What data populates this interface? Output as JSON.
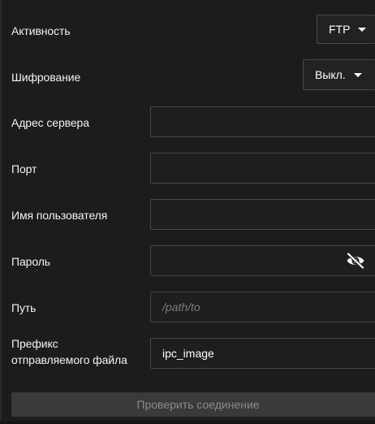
{
  "activity": {
    "label": "Активность",
    "value": "FTP"
  },
  "encryption": {
    "label": "Шифрование",
    "value": "Выкл."
  },
  "server_address": {
    "label": "Адрес сервера",
    "value": ""
  },
  "port": {
    "label": "Порт",
    "value": ""
  },
  "username": {
    "label": "Имя пользователя",
    "value": ""
  },
  "password": {
    "label": "Пароль",
    "value": "",
    "icon": "eye-slash-icon"
  },
  "path": {
    "label": "Путь",
    "value": "",
    "placeholder": "/path/to"
  },
  "file_prefix": {
    "label_line1": "Префикс",
    "label_line2": "отправляемого файла",
    "value": "ipc_image"
  },
  "test_button": {
    "label": "Проверить соединение"
  }
}
